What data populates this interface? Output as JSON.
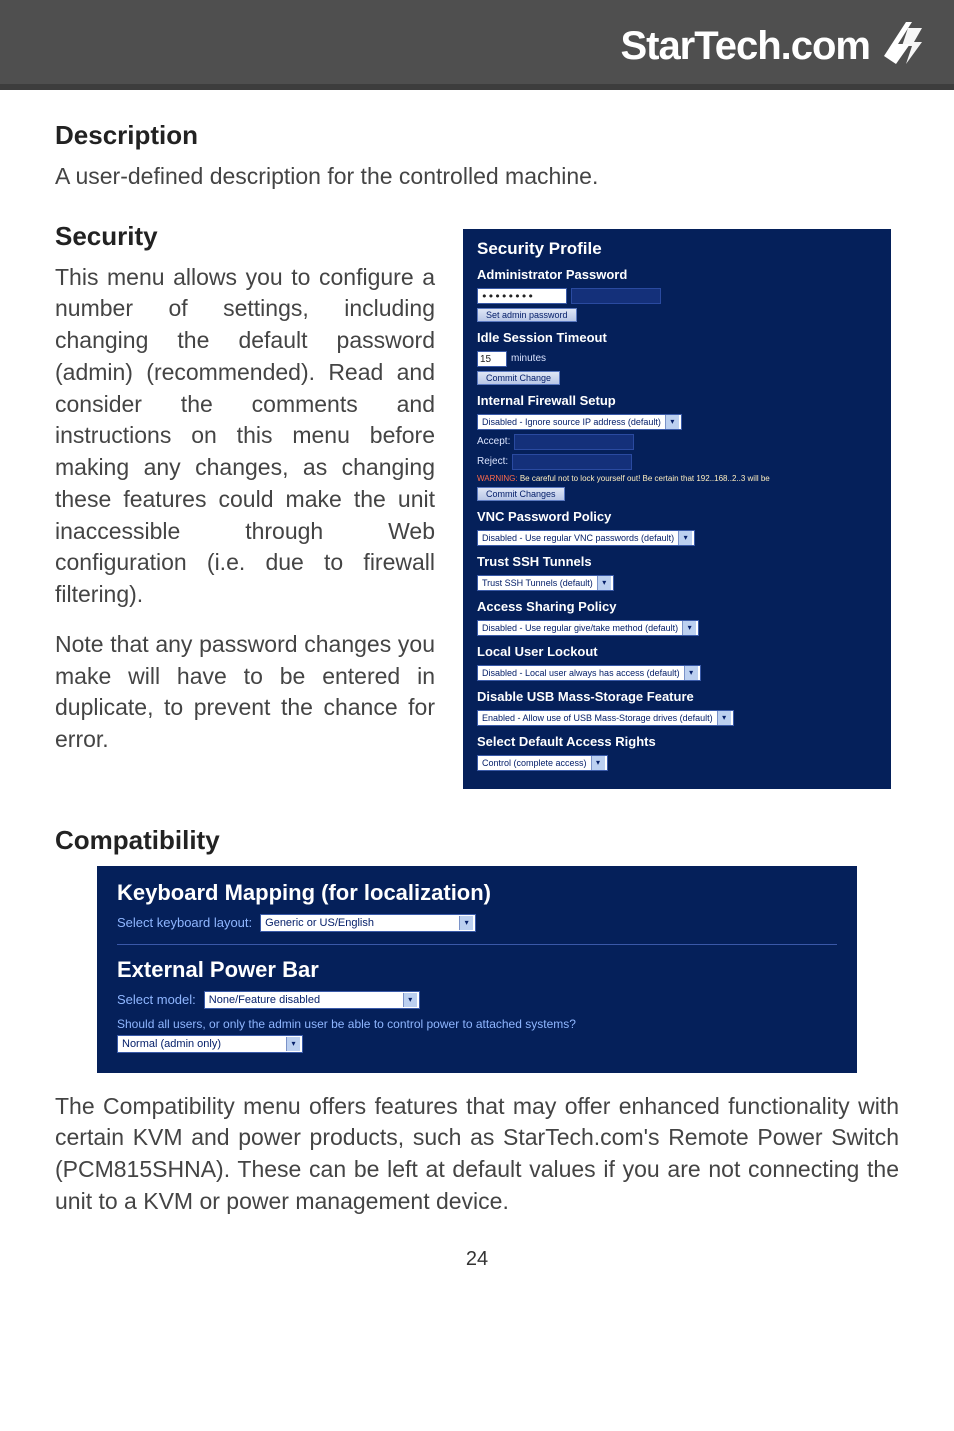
{
  "brand": "StarTech.com",
  "page_number": "24",
  "sections": {
    "description": {
      "heading": "Description",
      "body": "A user-defined description for the controlled machine."
    },
    "security": {
      "heading": "Security",
      "p1": "This menu allows you to configure a number of settings, including changing the default password (admin) (recommended). Read and consider the comments and instructions on this menu before making any changes, as changing these features could make the unit inaccessible through Web configuration (i.e. due to firewall filtering).",
      "p2": "Note that any password changes you make will have to be entered in duplicate, to prevent the chance for error."
    },
    "compatibility": {
      "heading": "Compatibility",
      "body": "The Compatibility menu offers features that may offer enhanced functionality with certain KVM and power products, such as StarTech.com's Remote Power Switch (PCM815SHNA). These can be left at default values if you are not connecting the unit to a KVM or power management device."
    }
  },
  "security_panel": {
    "title": "Security Profile",
    "admin_pw": {
      "heading": "Administrator Password",
      "value": "••••••••",
      "button": "Set admin password"
    },
    "idle": {
      "heading": "Idle Session Timeout",
      "value": "15",
      "unit": "minutes",
      "button": "Commit Change"
    },
    "firewall": {
      "heading": "Internal Firewall Setup",
      "select": "Disabled - Ignore source IP address (default)",
      "accept_label": "Accept:",
      "reject_label": "Reject:",
      "warning_prefix": "WARNING:",
      "warning": " Be careful not to lock yourself out! Be certain that 192..168..2..3 will be",
      "button": "Commit Changes"
    },
    "vnc": {
      "heading": "VNC Password Policy",
      "select": "Disabled - Use regular VNC passwords (default)"
    },
    "ssh": {
      "heading": "Trust SSH Tunnels",
      "select": "Trust SSH Tunnels (default)"
    },
    "access": {
      "heading": "Access Sharing Policy",
      "select": "Disabled - Use regular give/take method (default)"
    },
    "lockout": {
      "heading": "Local User Lockout",
      "select": "Disabled - Local user always has access (default)"
    },
    "usb": {
      "heading": "Disable USB Mass-Storage Feature",
      "select": "Enabled - Allow use of USB Mass-Storage drives (default)"
    },
    "rights": {
      "heading": "Select Default Access Rights",
      "select": "Control (complete access)"
    }
  },
  "compat_panel": {
    "kbmap_heading": "Keyboard Mapping (for localization)",
    "kbmap_label": "Select keyboard layout:",
    "kbmap_select": "Generic or US/English",
    "extpower_heading": "External Power Bar",
    "model_label": "Select model:",
    "model_select": "None/Feature disabled",
    "question": "Should all users, or only the admin user be able to control power to attached systems?",
    "mode_select": "Normal (admin only)"
  }
}
